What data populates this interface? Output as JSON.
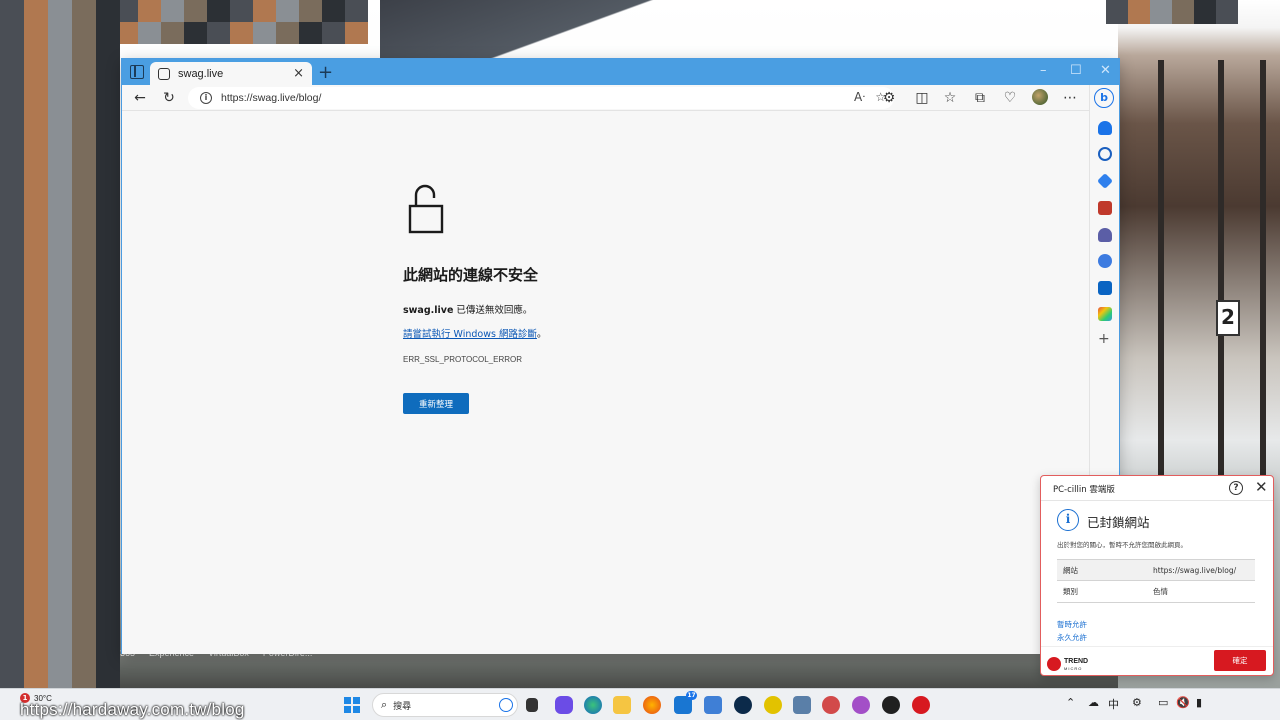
{
  "browser": {
    "tab_title": "swag.live",
    "tab_close": "×",
    "new_tab": "+",
    "url": "https://swag.live/blog/",
    "window_controls": {
      "minimize": "–",
      "maximize": "☐",
      "close": "✕"
    }
  },
  "error_page": {
    "title": "此網站的連線不安全",
    "host": "swag.live",
    "host_suffix": " 已傳送無效回應。",
    "suggestion_link": "請嘗試執行 Windows 網路診斷",
    "suggestion_suffix": "。",
    "error_code": "ERR_SSL_PROTOCOL_ERROR",
    "reload_label": "重新整理"
  },
  "popup": {
    "app_name": "PC-cillin 雲端版",
    "heading": "已封鎖網站",
    "description": "出於對您的關心，暫時不允許您開啟此網頁。",
    "rows": [
      {
        "key": "網站",
        "value": "https://swag.live/blog/"
      },
      {
        "key": "類別",
        "value": "色情"
      }
    ],
    "allow_temp": "暫時允許",
    "allow_perm": "永久允許",
    "brand": "TREND",
    "brand_sub": "MICRO",
    "ok_label": "確定"
  },
  "taskbar": {
    "weather_badge": "1",
    "temperature": "30°C",
    "search_placeholder": "搜尋",
    "app_badge": "17",
    "ime": "中"
  },
  "desktop": {
    "watermark": "https://hardaway.com.tw/blog",
    "shortcut_labels": [
      "365",
      "Experience",
      "VirtualBox",
      "PowerDire..."
    ]
  },
  "colors": {
    "browser_frame": "#4a9ee2",
    "primary_button": "#0f6cbd",
    "link": "#0b57b5",
    "popup_accent": "#d71920"
  }
}
